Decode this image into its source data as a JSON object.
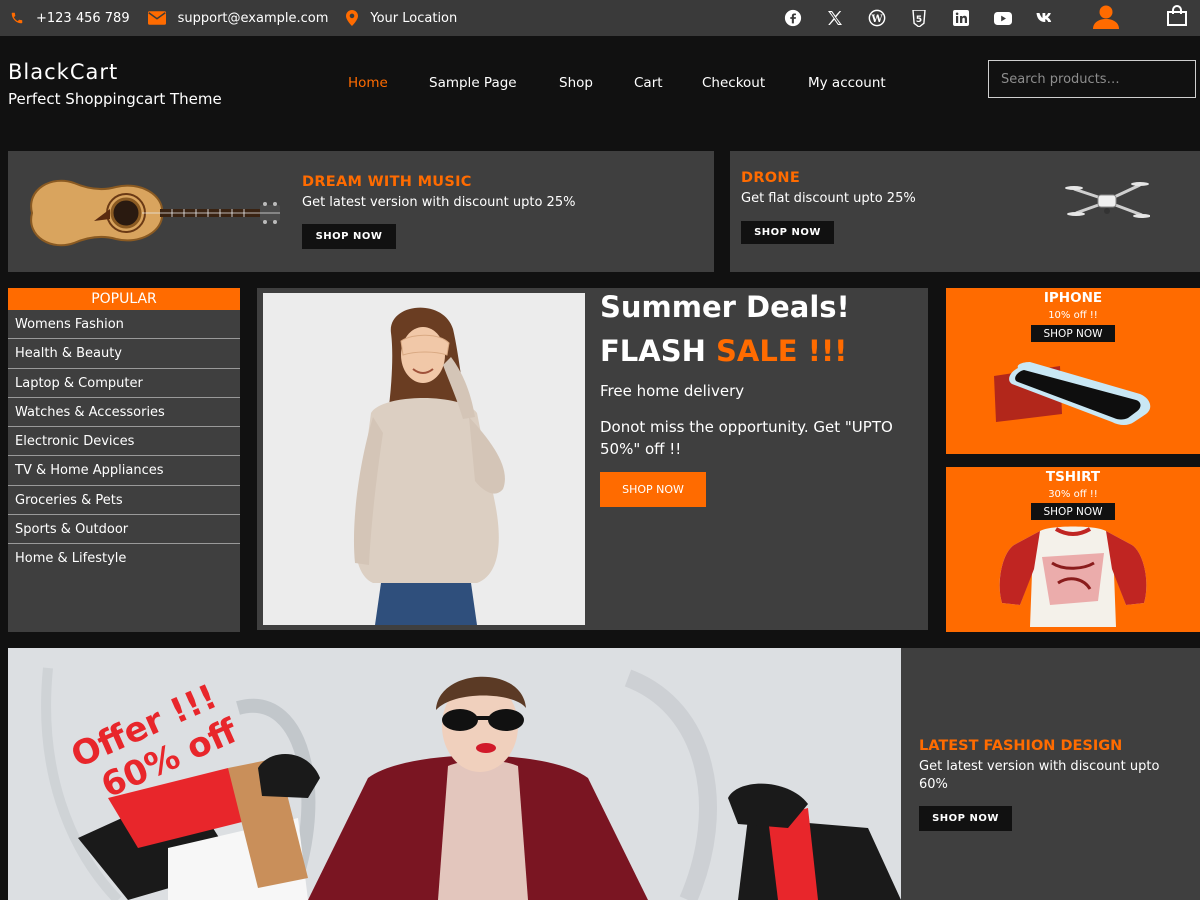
{
  "colors": {
    "accent": "#ff6b00",
    "panel": "#3f3f3f",
    "background": "#111111",
    "topbar": "#3a3a3a"
  },
  "topbar": {
    "phone": "+123 456 789",
    "email": "support@example.com",
    "location": "Your Location",
    "icons": {
      "phone": "phone-icon",
      "email": "envelope-icon",
      "location": "map-pin-icon"
    },
    "social": [
      "facebook-icon",
      "x-twitter-icon",
      "wordpress-icon",
      "html5-icon",
      "linkedin-icon",
      "youtube-icon",
      "vk-icon"
    ],
    "account_icon": "user-icon",
    "cart_icon": "shopping-bag-icon"
  },
  "header": {
    "site_title": "BlackCart",
    "tagline": "Perfect Shoppingcart Theme",
    "nav": [
      "Home",
      "Sample Page",
      "Shop",
      "Cart",
      "Checkout",
      "My account"
    ],
    "active_nav": "Home",
    "search_placeholder": "Search products…"
  },
  "promos": [
    {
      "title": "DREAM WITH MUSIC",
      "desc": "Get latest version with discount upto 25%",
      "button": "SHOP NOW",
      "image": "acoustic-guitar"
    },
    {
      "title": "DRONE",
      "desc": "Get flat discount upto 25%",
      "button": "SHOP NOW",
      "image": "drone"
    }
  ],
  "sidebar": {
    "heading": "POPULAR",
    "items": [
      "Womens Fashion",
      "Health & Beauty",
      "Laptop & Computer",
      "Watches & Accessories",
      "Electronic Devices",
      "TV & Home Appliances",
      "Groceries & Pets",
      "Sports & Outdoor",
      "Home & Lifestyle"
    ]
  },
  "hero": {
    "heading_line1": "Summer Deals!",
    "heading_line2_white": "FLASH",
    "heading_line2_orange": "SALE !!!",
    "text1": "Free home delivery",
    "text2": "Donot miss the opportunity. Get \"UPTO 50%\" off !!",
    "button": "SHOP NOW",
    "image": "woman-in-beige-sweater"
  },
  "product_cards": [
    {
      "title": "IPHONE",
      "offer": "10% off !!",
      "button": "SHOP NOW",
      "image": "smartphone"
    },
    {
      "title": "TSHIRT",
      "offer": "30% off !!",
      "button": "SHOP NOW",
      "image": "raglan-tshirt"
    }
  ],
  "banner": {
    "overlay_line1": "Offer !!!",
    "overlay_line2": "60% off",
    "title": "LATEST FASHION DESIGN",
    "desc": "Get latest version with discount upto 60%",
    "button": "SHOP NOW",
    "image": "woman-with-shopping-bags"
  }
}
